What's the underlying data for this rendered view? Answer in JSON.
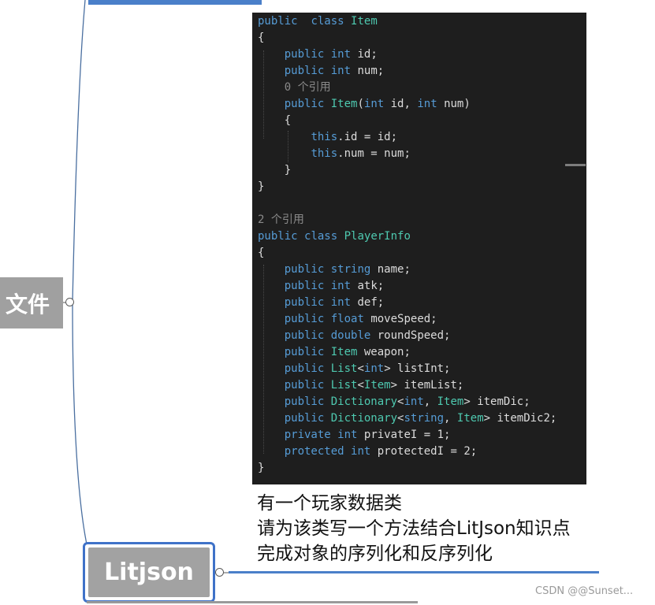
{
  "mindmap": {
    "left_node_label": "文件",
    "litjson_node_label": "Litjson"
  },
  "code": {
    "lines": [
      {
        "parts": [
          [
            "kw",
            "public"
          ],
          [
            "",
            "  "
          ],
          [
            "kw",
            "class"
          ],
          [
            "",
            " "
          ],
          [
            "ty",
            "Item"
          ]
        ]
      },
      {
        "parts": [
          [
            "",
            "{"
          ]
        ]
      },
      {
        "parts": [
          [
            "",
            "    "
          ],
          [
            "kw",
            "public"
          ],
          [
            "",
            " "
          ],
          [
            "kw",
            "int"
          ],
          [
            "",
            " id;"
          ]
        ]
      },
      {
        "parts": [
          [
            "",
            "    "
          ],
          [
            "kw",
            "public"
          ],
          [
            "",
            " "
          ],
          [
            "kw",
            "int"
          ],
          [
            "",
            " num;"
          ]
        ]
      },
      {
        "parts": [
          [
            "",
            "    "
          ],
          [
            "ref",
            "0 个引用"
          ]
        ]
      },
      {
        "parts": [
          [
            "",
            "    "
          ],
          [
            "kw",
            "public"
          ],
          [
            "",
            " "
          ],
          [
            "ty",
            "Item"
          ],
          [
            "",
            "("
          ],
          [
            "kw",
            "int"
          ],
          [
            "",
            " id, "
          ],
          [
            "kw",
            "int"
          ],
          [
            "",
            " num)"
          ]
        ]
      },
      {
        "parts": [
          [
            "",
            "    {"
          ]
        ]
      },
      {
        "parts": [
          [
            "",
            "        "
          ],
          [
            "kw",
            "this"
          ],
          [
            "",
            ".id = id;"
          ]
        ]
      },
      {
        "parts": [
          [
            "",
            "        "
          ],
          [
            "kw",
            "this"
          ],
          [
            "",
            ".num = num;"
          ]
        ]
      },
      {
        "parts": [
          [
            "",
            "    }"
          ]
        ]
      },
      {
        "parts": [
          [
            "",
            "}"
          ]
        ]
      },
      {
        "parts": [
          [
            "",
            ""
          ]
        ]
      },
      {
        "parts": [
          [
            "ref",
            "2 个引用"
          ]
        ]
      },
      {
        "parts": [
          [
            "kw",
            "public"
          ],
          [
            "",
            " "
          ],
          [
            "kw",
            "class"
          ],
          [
            "",
            " "
          ],
          [
            "ty",
            "PlayerInfo"
          ]
        ]
      },
      {
        "parts": [
          [
            "",
            "{"
          ]
        ]
      },
      {
        "parts": [
          [
            "",
            "    "
          ],
          [
            "kw",
            "public"
          ],
          [
            "",
            " "
          ],
          [
            "kw",
            "string"
          ],
          [
            "",
            " name;"
          ]
        ]
      },
      {
        "parts": [
          [
            "",
            "    "
          ],
          [
            "kw",
            "public"
          ],
          [
            "",
            " "
          ],
          [
            "kw",
            "int"
          ],
          [
            "",
            " atk;"
          ]
        ]
      },
      {
        "parts": [
          [
            "",
            "    "
          ],
          [
            "kw",
            "public"
          ],
          [
            "",
            " "
          ],
          [
            "kw",
            "int"
          ],
          [
            "",
            " def;"
          ]
        ]
      },
      {
        "parts": [
          [
            "",
            "    "
          ],
          [
            "kw",
            "public"
          ],
          [
            "",
            " "
          ],
          [
            "kw",
            "float"
          ],
          [
            "",
            " moveSpeed;"
          ]
        ]
      },
      {
        "parts": [
          [
            "",
            "    "
          ],
          [
            "kw",
            "public"
          ],
          [
            "",
            " "
          ],
          [
            "kw",
            "double"
          ],
          [
            "",
            " roundSpeed;"
          ]
        ]
      },
      {
        "parts": [
          [
            "",
            "    "
          ],
          [
            "kw",
            "public"
          ],
          [
            "",
            " "
          ],
          [
            "ty",
            "Item"
          ],
          [
            "",
            " weapon;"
          ]
        ]
      },
      {
        "parts": [
          [
            "",
            "    "
          ],
          [
            "kw",
            "public"
          ],
          [
            "",
            " "
          ],
          [
            "ty",
            "List"
          ],
          [
            "",
            "<"
          ],
          [
            "kw",
            "int"
          ],
          [
            "",
            "> listInt;"
          ]
        ]
      },
      {
        "parts": [
          [
            "",
            "    "
          ],
          [
            "kw",
            "public"
          ],
          [
            "",
            " "
          ],
          [
            "ty",
            "List"
          ],
          [
            "",
            "<"
          ],
          [
            "ty",
            "Item"
          ],
          [
            "",
            "> itemList;"
          ]
        ]
      },
      {
        "parts": [
          [
            "",
            "    "
          ],
          [
            "kw",
            "public"
          ],
          [
            "",
            " "
          ],
          [
            "ty",
            "Dictionary"
          ],
          [
            "",
            "<"
          ],
          [
            "kw",
            "int"
          ],
          [
            "",
            ", "
          ],
          [
            "ty",
            "Item"
          ],
          [
            "",
            "> itemDic;"
          ]
        ]
      },
      {
        "parts": [
          [
            "",
            "    "
          ],
          [
            "kw",
            "public"
          ],
          [
            "",
            " "
          ],
          [
            "ty",
            "Dictionary"
          ],
          [
            "",
            "<"
          ],
          [
            "kw",
            "string"
          ],
          [
            "",
            ", "
          ],
          [
            "ty",
            "Item"
          ],
          [
            "",
            "> itemDic2;"
          ]
        ]
      },
      {
        "parts": [
          [
            "",
            "    "
          ],
          [
            "kw",
            "private"
          ],
          [
            "",
            " "
          ],
          [
            "kw",
            "int"
          ],
          [
            "",
            " privateI = 1;"
          ]
        ]
      },
      {
        "parts": [
          [
            "",
            "    "
          ],
          [
            "kw",
            "protected"
          ],
          [
            "",
            " "
          ],
          [
            "kw",
            "int"
          ],
          [
            "",
            " protectedI = 2;"
          ]
        ]
      },
      {
        "parts": [
          [
            "",
            "}"
          ]
        ]
      }
    ]
  },
  "description": {
    "line1": "有一个玩家数据类",
    "line2": "请为该类写一个方法结合LitJson知识点",
    "line3": "完成对象的序列化和反序列化"
  },
  "watermark": "CSDN @@Sunset...",
  "colors": {
    "accent_blue": "#4a7fc9",
    "node_gray": "#a2a2a2",
    "code_bg": "#1e1e1e",
    "keyword": "#569cd6",
    "type": "#4ec9b0"
  }
}
